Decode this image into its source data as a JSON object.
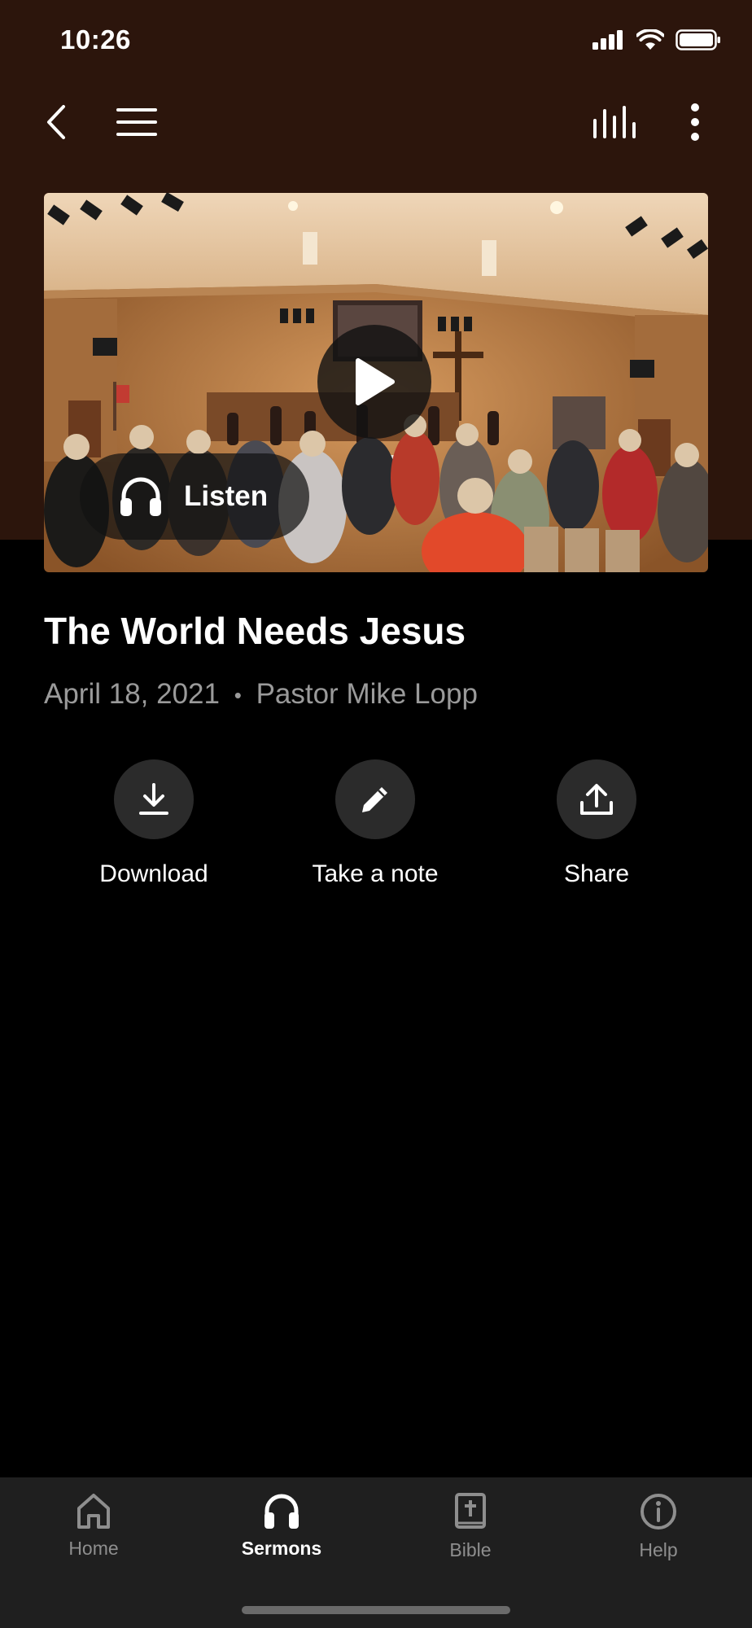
{
  "status_bar": {
    "time": "10:26"
  },
  "sermon": {
    "title": "The World Needs Jesus",
    "date": "April 18, 2021",
    "separator": "•",
    "speaker": "Pastor Mike Lopp",
    "listen_label": "Listen"
  },
  "actions": [
    {
      "label": "Download",
      "icon": "download-icon"
    },
    {
      "label": "Take a note",
      "icon": "pencil-icon"
    },
    {
      "label": "Share",
      "icon": "share-icon"
    }
  ],
  "tabs": [
    {
      "label": "Home",
      "icon": "home-icon",
      "active": false
    },
    {
      "label": "Sermons",
      "icon": "headphones-icon",
      "active": true
    },
    {
      "label": "Bible",
      "icon": "bible-icon",
      "active": false
    },
    {
      "label": "Help",
      "icon": "info-icon",
      "active": false
    }
  ],
  "colors": {
    "header_bg": "#2c150c",
    "tabbar_bg": "#1f1f1f",
    "muted_text": "#9a9a9a"
  }
}
